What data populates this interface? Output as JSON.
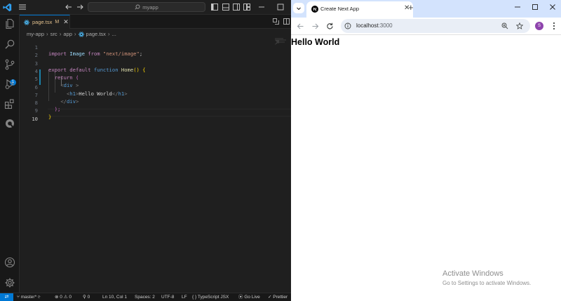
{
  "vscode": {
    "search_text": "myapp",
    "tab": {
      "name": "page.tsx",
      "status": "M"
    },
    "breadcrumb": [
      "my-app",
      "src",
      "app",
      "page.tsx",
      "..."
    ],
    "scm_badge": "1",
    "lines": [
      {
        "n": "1"
      },
      {
        "n": "2"
      },
      {
        "n": "3"
      },
      {
        "n": "4"
      },
      {
        "n": "5"
      },
      {
        "n": "6"
      },
      {
        "n": "7"
      },
      {
        "n": "8"
      },
      {
        "n": "9"
      },
      {
        "n": "10"
      }
    ],
    "code": {
      "l1": {
        "kw": "import",
        "id": "Image",
        "from": "from",
        "str": "\"next/image\"",
        "semi": ";"
      },
      "l3": {
        "export": "export",
        "default": "default",
        "function": "function",
        "name": "Home",
        "parens": "()",
        "brace": "{"
      },
      "l4": {
        "return": "return",
        "paren": "("
      },
      "l5": {
        "open": "<",
        "tag": "div",
        "close": " >"
      },
      "l6": {
        "open": "<",
        "tag": "h1",
        "close": ">",
        "text": "Hello World",
        "endopen": "</",
        "endtag": "h1",
        "endclose": ">"
      },
      "l7": {
        "open": "</",
        "tag": "div",
        "close": ">"
      },
      "l8": {
        "text": ");"
      },
      "l9": {
        "text": "}"
      }
    },
    "status": {
      "branch": "master*",
      "problems": "0",
      "warnings": "0",
      "ports": "0",
      "position": "Ln 10, Col 1",
      "spaces": "Spaces: 2",
      "encoding": "UTF-8",
      "eol": "LF",
      "language": "TypeScript JSX",
      "golive": "Go Live",
      "prettier": "Prettier"
    }
  },
  "chrome": {
    "tab_title": "Create Next App",
    "url_host": "localhost",
    "url_port": ":3000",
    "avatar_letter": "S"
  },
  "page": {
    "heading": "Hello World"
  },
  "watermark": {
    "title": "Activate Windows",
    "subtitle": "Go to Settings to activate Windows."
  },
  "colors": {
    "accent": "#0078d4",
    "modified": "#e2c08d",
    "chrome_tabstrip": "#d3e3fd"
  }
}
